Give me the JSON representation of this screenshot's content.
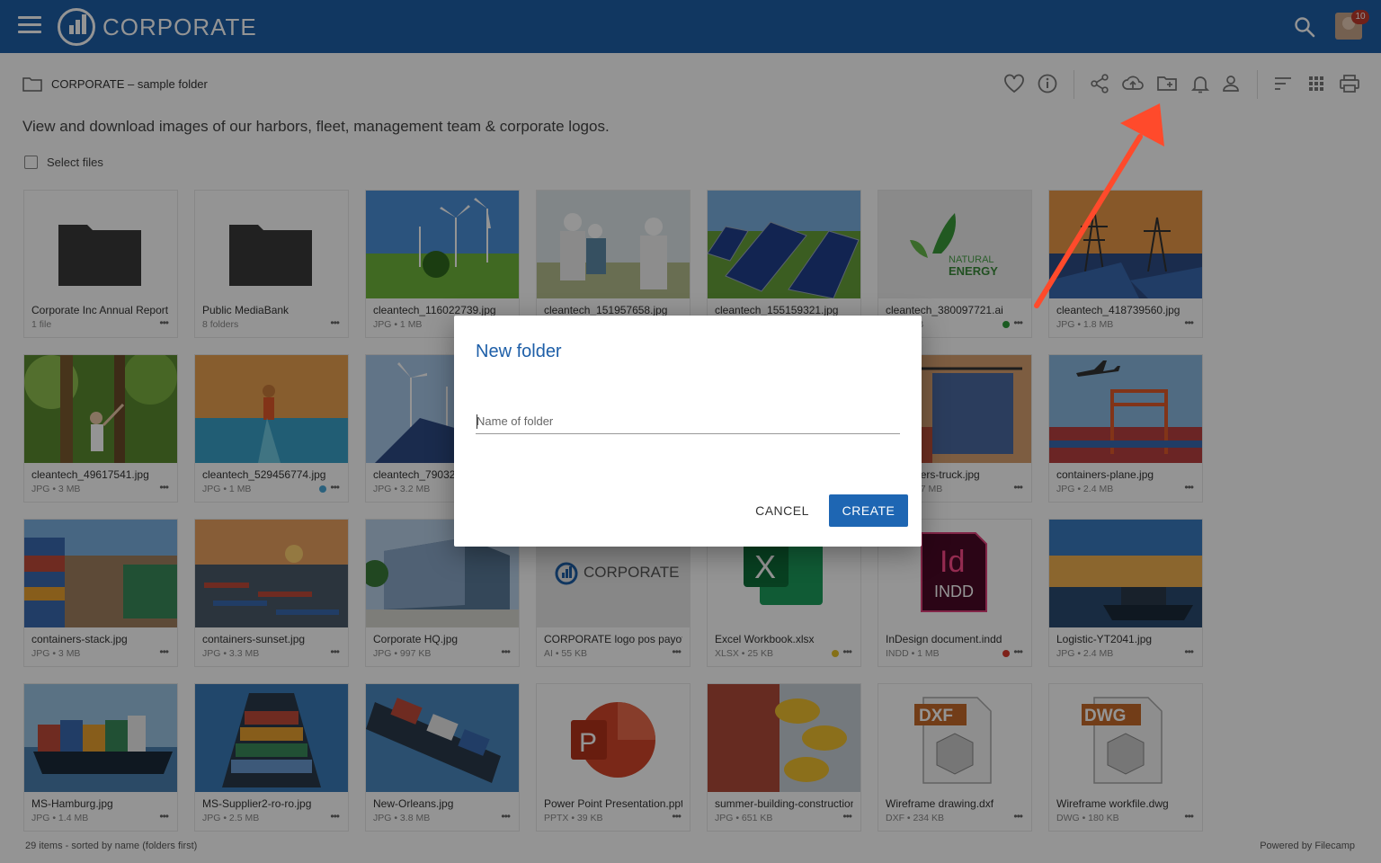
{
  "header": {
    "brand": "CORPORATE",
    "notification_count": "10"
  },
  "breadcrumb": {
    "label": "CORPORATE – sample folder"
  },
  "description": "View and download images of our harbors, fleet, management team & corporate logos.",
  "select_files_label": "Select files",
  "toolbar_icons": [
    "heart-icon",
    "info-icon",
    "share-icon",
    "cloud-upload-icon",
    "new-folder-icon",
    "bell-icon",
    "person-icon",
    "sort-icon",
    "grid-view-icon",
    "print-icon"
  ],
  "items": [
    {
      "name": "Corporate Inc Annual Report",
      "meta": "1 file",
      "kind": "folder"
    },
    {
      "name": "Public MediaBank",
      "meta": "8 folders",
      "kind": "folder"
    },
    {
      "name": "cleantech_116022739.jpg",
      "meta": "JPG • 1 MB",
      "kind": "wind"
    },
    {
      "name": "cleantech_151957658.jpg",
      "meta": "JPG • 1 MB",
      "kind": "engineers"
    },
    {
      "name": "cleantech_155159321.jpg",
      "meta": "JPG • 1 MB",
      "kind": "solar"
    },
    {
      "name": "cleantech_380097721.ai",
      "meta": "AI • 1 KB",
      "kind": "natural-energy",
      "dot": "#2e9d3a"
    },
    {
      "name": "cleantech_418739560.jpg",
      "meta": "JPG • 1.8 MB",
      "kind": "pylons"
    },
    {
      "name": "cleantech_49617541.jpg",
      "meta": "JPG • 3 MB",
      "kind": "forest"
    },
    {
      "name": "cleantech_529456774.jpg",
      "meta": "JPG • 1 MB",
      "kind": "runner",
      "dot": "#4aa8d8"
    },
    {
      "name": "cleantech_790321.jpg",
      "meta": "JPG • 3.2 MB",
      "kind": "wind-solar"
    },
    {
      "name": "",
      "meta": "",
      "kind": "hidden"
    },
    {
      "name": "",
      "meta": "",
      "kind": "hidden"
    },
    {
      "name": "containers-truck.jpg",
      "meta": "JPG • 2.7 MB",
      "kind": "container-crane"
    },
    {
      "name": "containers-plane.jpg",
      "meta": "JPG • 2.4 MB",
      "kind": "containers-plane"
    },
    {
      "name": "containers-stack.jpg",
      "meta": "JPG • 3 MB",
      "kind": "containers-stack"
    },
    {
      "name": "containers-sunset.jpg",
      "meta": "JPG • 3.3 MB",
      "kind": "port-sunset"
    },
    {
      "name": "Corporate HQ.jpg",
      "meta": "JPG • 997 KB",
      "kind": "hq"
    },
    {
      "name": "CORPORATE logo pos payoff",
      "meta": "AI • 55 KB",
      "kind": "corp-logo"
    },
    {
      "name": "Excel Workbook.xlsx",
      "meta": "XLSX • 25 KB",
      "kind": "excel",
      "dot": "#e6c229"
    },
    {
      "name": "InDesign document.indd",
      "meta": "INDD • 1 MB",
      "kind": "indd",
      "dot": "#d93a2b"
    },
    {
      "name": "Logistic-YT2041.jpg",
      "meta": "JPG • 2.4 MB",
      "kind": "ship-sunset"
    },
    {
      "name": "MS-Hamburg.jpg",
      "meta": "JPG • 1.4 MB",
      "kind": "ship1"
    },
    {
      "name": "MS-Supplier2-ro-ro.jpg",
      "meta": "JPG • 2.5 MB",
      "kind": "ship2"
    },
    {
      "name": "New-Orleans.jpg",
      "meta": "JPG • 3.8 MB",
      "kind": "ship3"
    },
    {
      "name": "Power Point Presentation.pptx",
      "meta": "PPTX • 39 KB",
      "kind": "ppt"
    },
    {
      "name": "summer-building-construction.jpg",
      "meta": "JPG • 651 KB",
      "kind": "helmets"
    },
    {
      "name": "Wireframe drawing.dxf",
      "meta": "DXF • 234 KB",
      "kind": "dxf"
    },
    {
      "name": "Wireframe workfile.dwg",
      "meta": "DWG • 180 KB",
      "kind": "dwg"
    }
  ],
  "dialog": {
    "title": "New folder",
    "input_placeholder": "Name of folder",
    "input_value": "",
    "cancel_label": "CANCEL",
    "create_label": "CREATE"
  },
  "footer": {
    "summary": "29 items - sorted by name (folders first)",
    "powered_by": "Powered by Filecamp"
  },
  "colors": {
    "primary": "#1e5fa8",
    "create_button": "#1e66b3",
    "annotation_arrow": "#ff4a2b"
  }
}
